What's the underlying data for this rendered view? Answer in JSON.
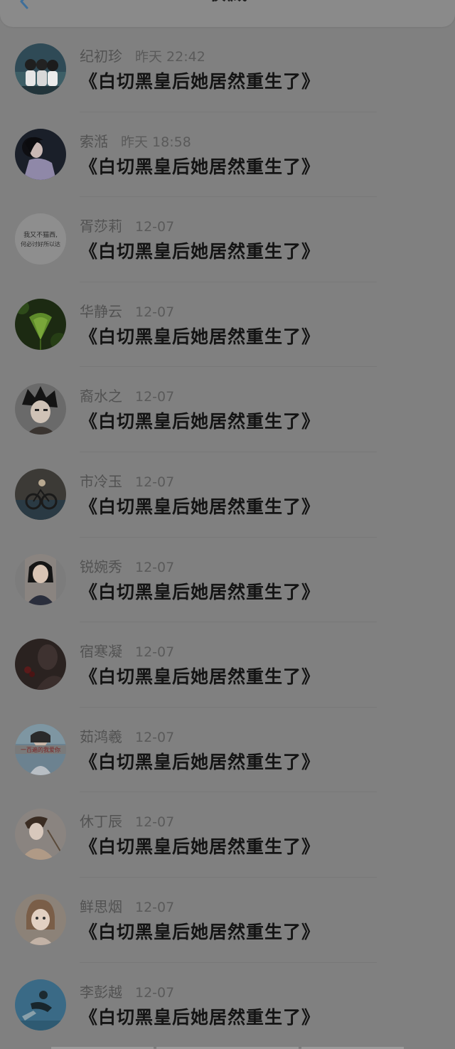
{
  "header": {
    "title": "收藏",
    "back_icon": "chevron-left-icon",
    "accent_color": "#3f6f9a"
  },
  "favorites": [
    {
      "name": "纪初珍",
      "time": "昨天 22:42",
      "title": "《白切黑皇后她居然重生了》"
    },
    {
      "name": "索湉",
      "time": "昨天 18:58",
      "title": "《白切黑皇后她居然重生了》"
    },
    {
      "name": "胥莎莉",
      "time": "12-07",
      "title": "《白切黑皇后她居然重生了》"
    },
    {
      "name": "华静云",
      "time": "12-07",
      "title": "《白切黑皇后她居然重生了》"
    },
    {
      "name": "裔水之",
      "time": "12-07",
      "title": "《白切黑皇后她居然重生了》"
    },
    {
      "name": "市冷玉",
      "time": "12-07",
      "title": "《白切黑皇后她居然重生了》"
    },
    {
      "name": "锐婉秀",
      "time": "12-07",
      "title": "《白切黑皇后她居然重生了》"
    },
    {
      "name": "宿寒凝",
      "time": "12-07",
      "title": "《白切黑皇后她居然重生了》"
    },
    {
      "name": "茹鸿羲",
      "time": "12-07",
      "title": "《白切黑皇后她居然重生了》"
    },
    {
      "name": "休丁辰",
      "time": "12-07",
      "title": "《白切黑皇后她居然重生了》"
    },
    {
      "name": "鲜思烟",
      "time": "12-07",
      "title": "《白切黑皇后她居然重生了》"
    },
    {
      "name": "李彭越",
      "time": "12-07",
      "title": "《白切黑皇后她居然重生了》"
    }
  ],
  "avatar_texts": {
    "a2_line1": "我又不猫西,",
    "a2_line2": "何必讨好所以达",
    "a8_caption": "一百遍的我爱你"
  }
}
